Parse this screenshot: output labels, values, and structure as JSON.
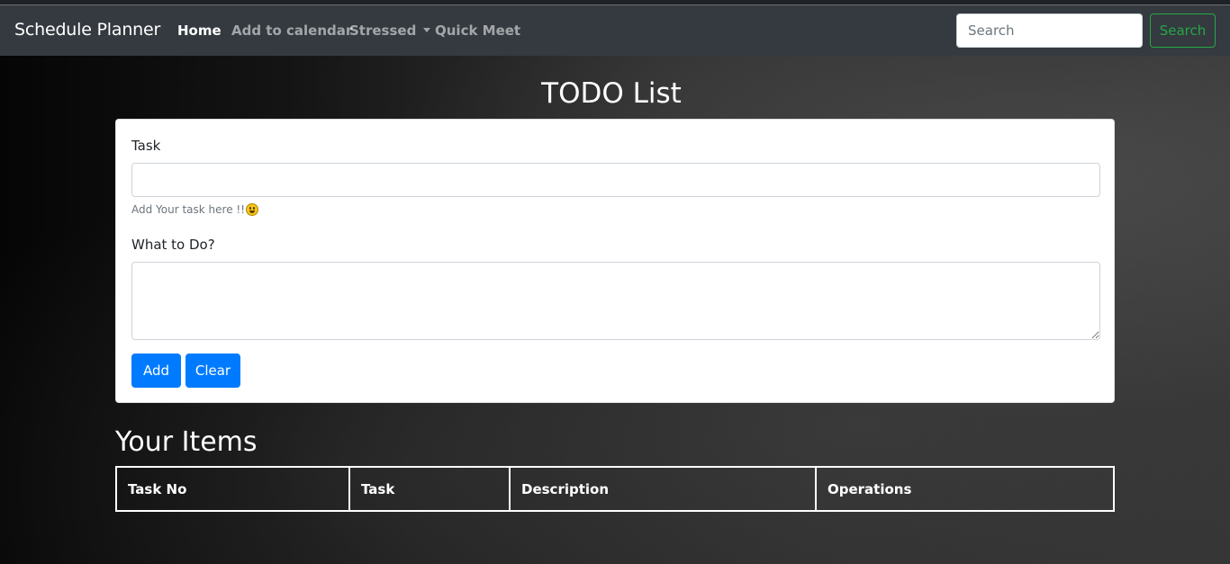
{
  "navbar": {
    "brand": "Schedule Planner",
    "links": [
      {
        "label": "Home",
        "active": true
      },
      {
        "label": "Add to calendar",
        "active": false
      },
      {
        "label": "Stressed",
        "active": false,
        "dropdown": true
      },
      {
        "label": "Quick Meet",
        "active": false
      }
    ],
    "search": {
      "placeholder": "Search",
      "value": "",
      "button_label": "Search"
    }
  },
  "main": {
    "title": "TODO List",
    "form": {
      "task_label": "Task",
      "task_value": "",
      "task_help": "Add Your task here !!",
      "task_help_icon": "smiley-face-emoji",
      "desc_label": "What to Do?",
      "desc_value": "",
      "add_label": "Add",
      "clear_label": "Clear"
    },
    "items": {
      "title": "Your Items",
      "columns": [
        "Task No",
        "Task",
        "Description",
        "Operations"
      ],
      "rows": []
    }
  },
  "colors": {
    "navbar_bg": "#343a40",
    "primary": "#007bff",
    "success": "#28a745"
  }
}
